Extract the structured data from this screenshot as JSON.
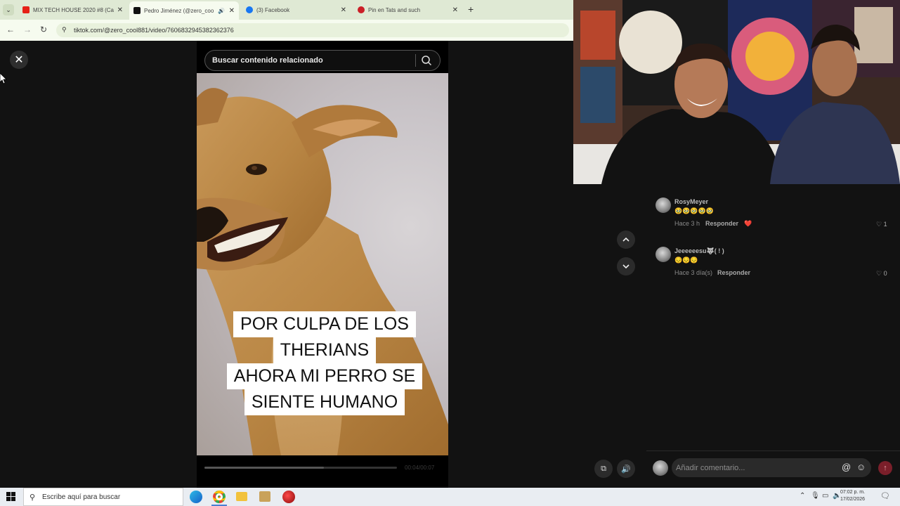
{
  "browser": {
    "tabs": [
      {
        "label": "MIX TECH HOUSE 2020 #8 (Ca",
        "icon": "youtube-icon",
        "color": "#e62117",
        "active": false
      },
      {
        "label": "Pedro Jiménez (@zero_coo",
        "icon": "tiktok-icon",
        "color": "#111111",
        "active": true
      },
      {
        "label": "(3) Facebook",
        "icon": "facebook-icon",
        "color": "#1877f2",
        "active": false
      },
      {
        "label": "Pin en Tats and such",
        "icon": "pinterest-icon",
        "color": "#cb1f27",
        "active": false
      }
    ],
    "new_tab_label": "+",
    "url": "tiktok.com/@zero_cool881/video/7606832945382362376"
  },
  "search": {
    "placeholder": "Buscar contenido relacionado"
  },
  "video": {
    "caption_lines": [
      "POR CULPA DE LOS",
      "THERIANS",
      "AHORA MI PERRO SE",
      "SIENTE HUMANO"
    ],
    "timecode": "00:04/00:07",
    "progress": 0.62
  },
  "comments": [
    {
      "username": "RosyMeyer",
      "text": "🥹🥹🥹🥹🥹",
      "time": "Hace 3 h",
      "reply_label": "Responder",
      "likes": "1"
    },
    {
      "username": "Jeeeeeesu🐺( ! )",
      "text": "😔😔😔",
      "time": "Hace 3 día(s)",
      "reply_label": "Responder",
      "likes": "0"
    }
  ],
  "comment_input": {
    "placeholder": "Añadir comentario..."
  },
  "taskbar": {
    "search_placeholder": "Escribe aquí para buscar",
    "time": "07:02 p. m.",
    "date": "17/02/2026"
  },
  "colors": {
    "accent_send": "#7a1f2a",
    "page_bg": "#121212",
    "browser_chrome": "#dfe9d4"
  }
}
